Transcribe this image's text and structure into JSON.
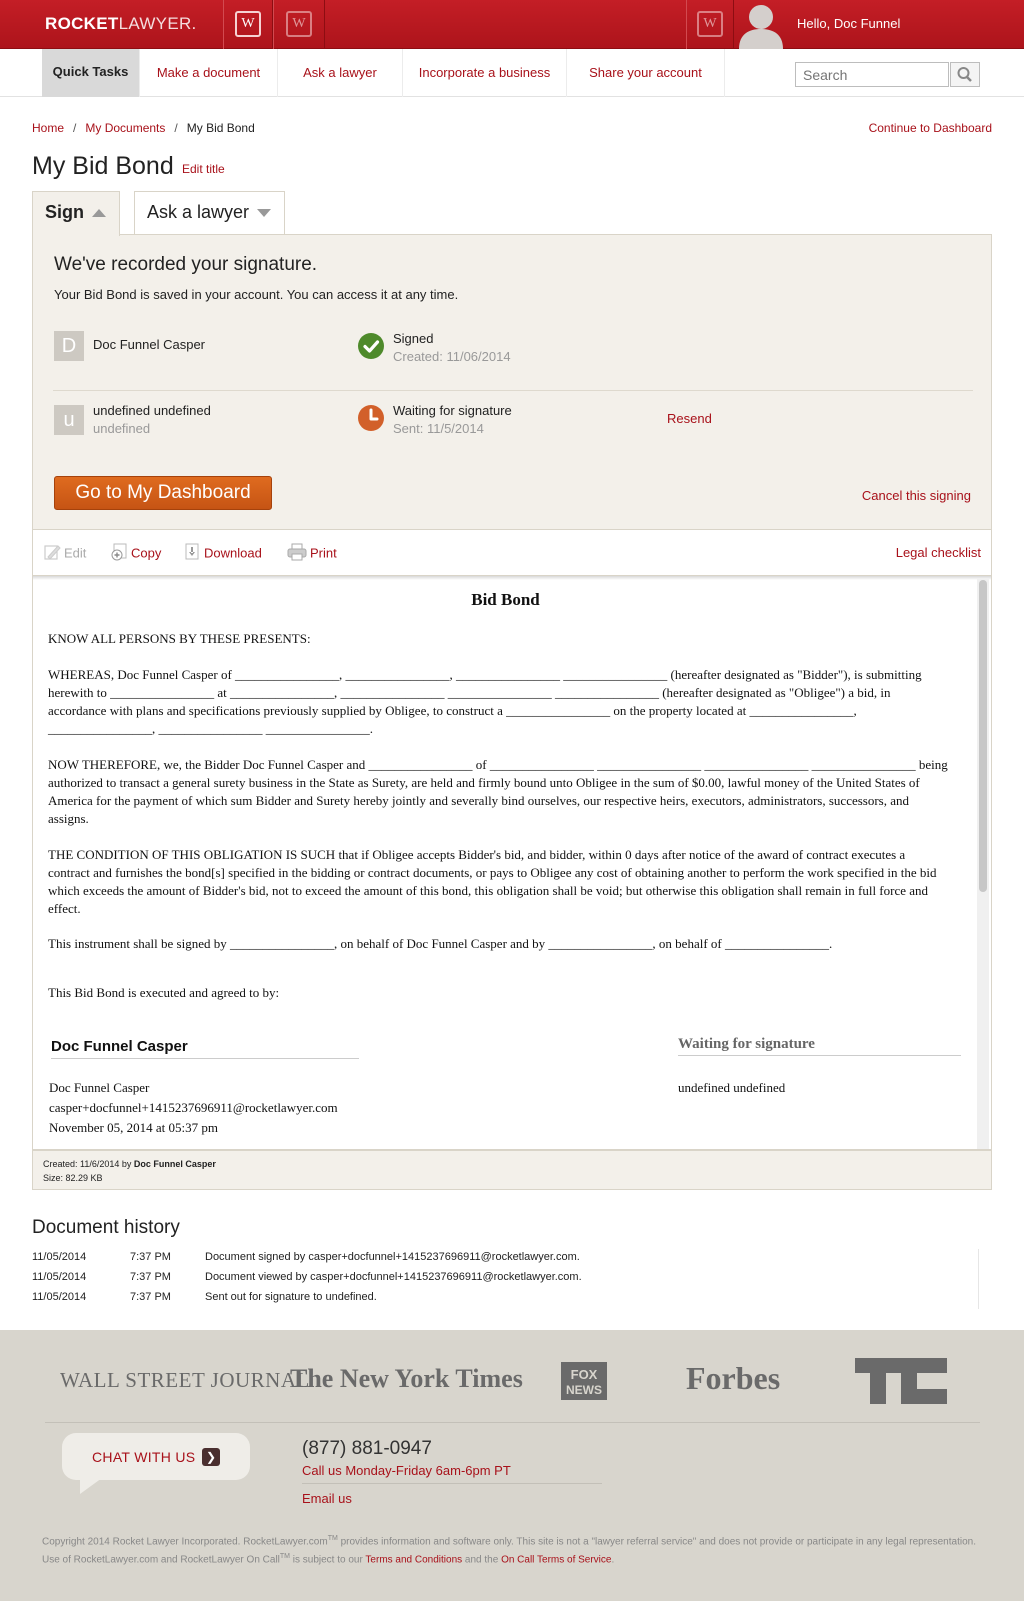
{
  "header": {
    "logo_bold": "ROCKET",
    "logo_light": "LAWYER",
    "logo_mark": ".",
    "badge_letter": "W",
    "greeting": "Hello, Doc Funnel"
  },
  "nav": {
    "quick_tasks": "Quick Tasks",
    "items": [
      "Make a document",
      "Ask a lawyer",
      "Incorporate a business",
      "Share your account"
    ],
    "search_placeholder": "Search"
  },
  "breadcrumb": {
    "home": "Home",
    "docs": "My Documents",
    "current": "My Bid Bond",
    "sep": "/",
    "continue": "Continue to Dashboard"
  },
  "page": {
    "title": "My Bid Bond",
    "edit_title": "Edit title"
  },
  "tabs": {
    "sign": "Sign",
    "ask": "Ask a lawyer"
  },
  "panel": {
    "title": "We've recorded your signature.",
    "subtitle": "Your Bid Bond is saved in your account. You can access it at any time.",
    "signers": [
      {
        "initial": "D",
        "name": "Doc Funnel Casper",
        "sub": "",
        "status": "Signed",
        "status_sub": "Created: 11/06/2014"
      },
      {
        "initial": "u",
        "name": "undefined undefined",
        "sub": "undefined",
        "status": "Waiting for signature",
        "status_sub": "Sent: 11/5/2014",
        "action": "Resend"
      }
    ],
    "dashboard_button": "Go to My Dashboard",
    "cancel": "Cancel this signing"
  },
  "toolbar": {
    "edit": "Edit",
    "copy": "Copy",
    "download": "Download",
    "print": "Print",
    "legal": "Legal checklist"
  },
  "document": {
    "title": "Bid Bond",
    "paragraphs": [
      "KNOW ALL PERSONS BY THESE PRESENTS:",
      "WHEREAS, Doc Funnel Casper of ________________, ________________, ________________ ________________ (hereafter designated as \"Bidder\"), is submitting herewith to ________________ at ________________, ________________ ________________ ________________ (hereafter designated as \"Obligee\") a bid, in accordance with plans and specifications previously supplied by Obligee, to construct a ________________ on the property located at ________________, ________________, ________________ ________________.",
      "NOW THEREFORE, we, the Bidder Doc Funnel Casper and ________________ of ________________ ________________ ________________ ________________ being authorized to transact a general surety business in the State as Surety, are held and firmly bound unto Obligee in the sum of $0.00, lawful money of the United States of America for the payment of which sum Bidder and Surety hereby jointly and severally bind ourselves, our respective heirs, executors, administrators, successors, and assigns.",
      "THE CONDITION OF THIS OBLIGATION IS SUCH that if Obligee accepts Bidder's bid, and bidder, within 0 days after notice of the award of contract executes a contract and furnishes the bond[s] specified in the bidding or contract documents, or pays to Obligee any cost of obtaining another to perform the work specified in the bid which exceeds the amount of Bidder's bid, not to exceed the amount of this bond, this obligation shall be void; but otherwise this obligation shall remain in full force and effect.",
      "This instrument shall be signed by ________________, on behalf of Doc Funnel Casper and by ________________, on behalf of ________________.",
      "This Bid Bond is executed and agreed to by:"
    ],
    "sig_left": {
      "heading": "Doc Funnel Casper",
      "name": "Doc Funnel Casper",
      "email": "casper+docfunnel+1415237696911@rocketlawyer.com",
      "date": "November 05, 2014 at 05:37 pm"
    },
    "sig_right": {
      "heading": "Waiting for signature",
      "name": "undefined undefined"
    }
  },
  "meta": {
    "created_label": "Created: 11/6/2014 by",
    "created_by": "Doc Funnel Casper",
    "size": "Size: 82.29 KB"
  },
  "history": {
    "title": "Document history",
    "rows": [
      {
        "date": "11/05/2014",
        "time": "7:37 PM",
        "text": "Document signed by casper+docfunnel+1415237696911@rocketlawyer.com."
      },
      {
        "date": "11/05/2014",
        "time": "7:37 PM",
        "text": "Document viewed by casper+docfunnel+1415237696911@rocketlawyer.com."
      },
      {
        "date": "11/05/2014",
        "time": "7:37 PM",
        "text": "Sent out for signature to undefined."
      }
    ]
  },
  "footer": {
    "press": [
      "WALL STREET JOURNAL",
      "The New York Times",
      "FOX NEWS",
      "Forbes",
      "TC"
    ],
    "chat": "CHAT WITH US",
    "phone": "(877) 881-0947",
    "hours": "Call us Monday-Friday 6am-6pm PT",
    "email": "Email us",
    "copyright_a": "Copyright 2014 Rocket Lawyer Incorporated. RocketLawyer.com",
    "tm": "TM",
    "copyright_b": " provides information and software only. This site is not a \"lawyer referral service\" and does not provide or participate in any legal representation. Use of RocketLawyer.com and RocketLawyer On Call",
    "copyright_c": " is subject to our ",
    "terms": "Terms and Conditions",
    "and_the": " and the ",
    "oncall_terms": "On Call Terms of Service",
    "period": "."
  },
  "colors": {
    "brand_red": "#c41e26",
    "link": "#a8111a",
    "orange": "#d4611a",
    "signed_green": "#4e8a2b",
    "waiting_orange": "#d2602a"
  }
}
